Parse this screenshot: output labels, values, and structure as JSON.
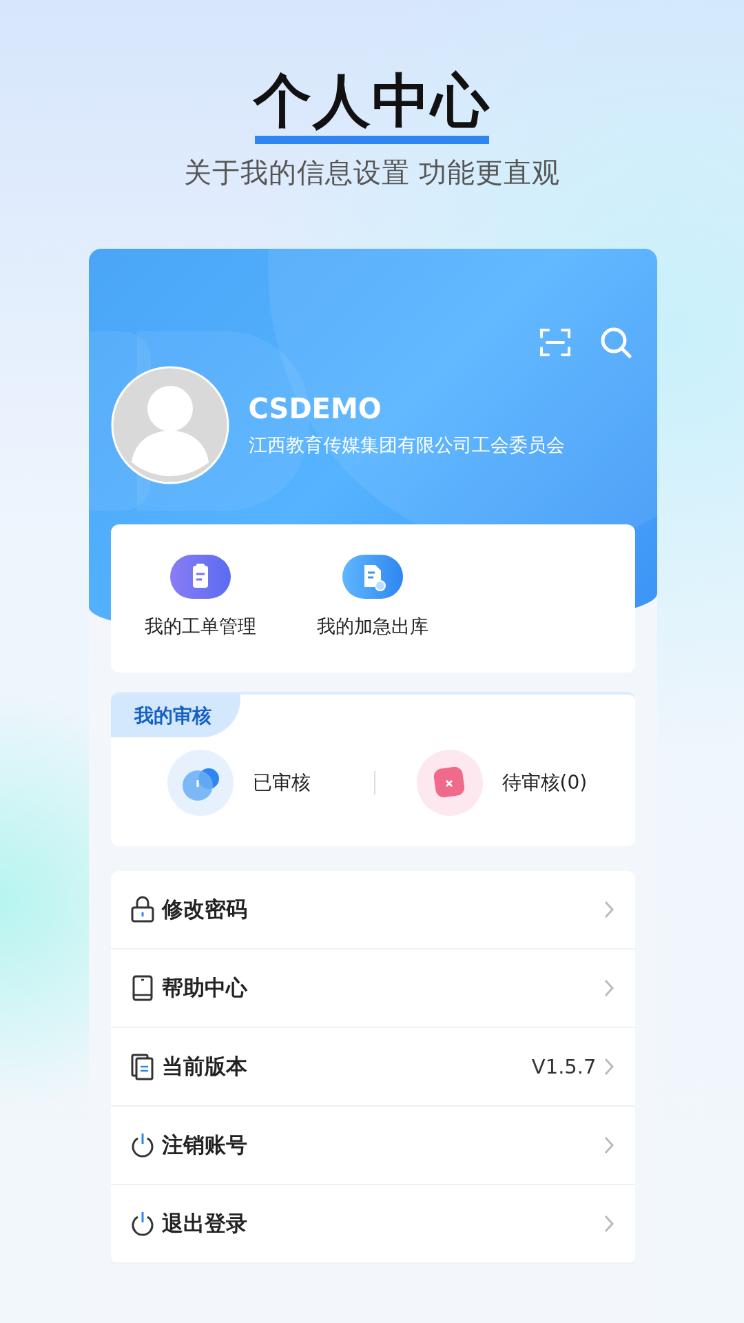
{
  "promo": {
    "title": "个人中心",
    "subtitle": "关于我的信息设置 功能更直观"
  },
  "profile": {
    "name": "CSDEMO",
    "organization": "江西教育传媒集团有限公司工会委员会"
  },
  "quick_actions": [
    {
      "label": "我的工单管理",
      "kind": "clipboard"
    },
    {
      "label": "我的加急出库",
      "kind": "document"
    }
  ],
  "audit": {
    "title": "我的审核",
    "items": [
      {
        "label": "已审核",
        "kind": "done"
      },
      {
        "label": "待审核(0)",
        "kind": "pending"
      }
    ]
  },
  "menu": [
    {
      "label": "修改密码",
      "kind": "lock"
    },
    {
      "label": "帮助中心",
      "kind": "device"
    },
    {
      "label": "当前版本",
      "kind": "pages",
      "value": "V1.5.7"
    },
    {
      "label": "注销账号",
      "kind": "power"
    },
    {
      "label": "退出登录",
      "kind": "power"
    }
  ]
}
